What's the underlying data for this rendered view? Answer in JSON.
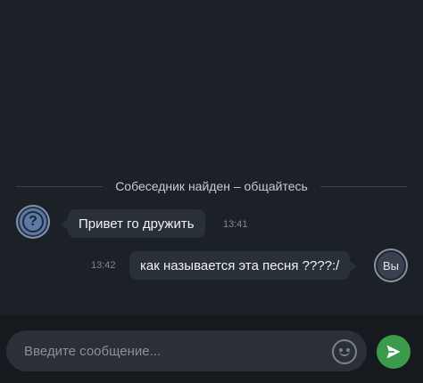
{
  "chat": {
    "system_message": "Собеседник найден – общайтесь",
    "messages": [
      {
        "sender": "stranger",
        "avatar_text": "?",
        "text": "Привет го дружить",
        "time": "13:41"
      },
      {
        "sender": "me",
        "avatar_text": "Вы",
        "text": "как называется эта песня ????:/",
        "time": "13:42"
      }
    ]
  },
  "input": {
    "placeholder": "Введите сообщение..."
  },
  "icons": {
    "emoji": "emoji-smile-icon",
    "send": "send-arrow-icon"
  },
  "colors": {
    "background": "#1c2128",
    "bubble": "#2a3038",
    "send_button": "#3b9b4a",
    "stranger_avatar": "#5c7aa5"
  }
}
